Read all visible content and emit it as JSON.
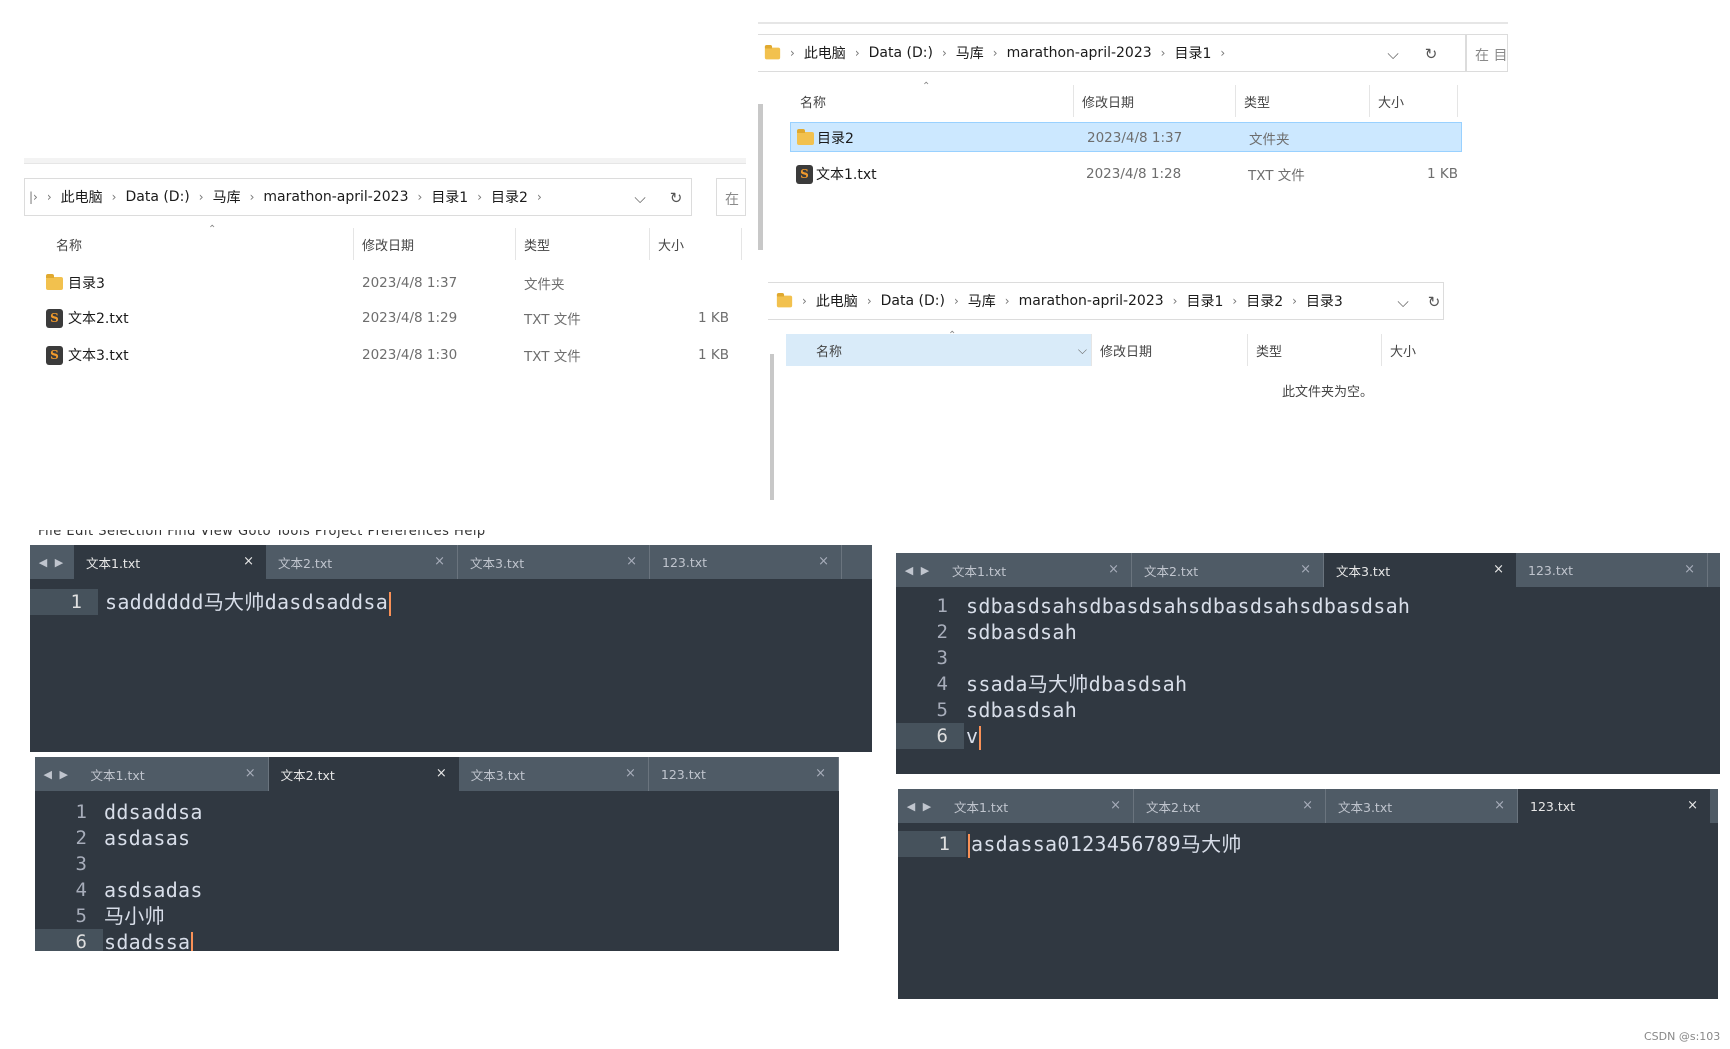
{
  "explorer1": {
    "crumbs": [
      "此电脑",
      "Data (D:)",
      "马库",
      "marathon-april-2023",
      "目录1",
      "目录2"
    ],
    "search_placeholder": "在 |",
    "columns": {
      "name": "名称",
      "modified": "修改日期",
      "type": "类型",
      "size": "大小"
    },
    "rows": [
      {
        "name": "目录3",
        "modified": "2023/4/8 1:37",
        "type": "文件夹",
        "size": "",
        "icon": "folder-icon"
      },
      {
        "name": "文本2.txt",
        "modified": "2023/4/8 1:29",
        "type": "TXT 文件",
        "size": "1 KB",
        "icon": "sublime-file-icon"
      },
      {
        "name": "文本3.txt",
        "modified": "2023/4/8 1:30",
        "type": "TXT 文件",
        "size": "1 KB",
        "icon": "sublime-file-icon"
      }
    ]
  },
  "explorer2": {
    "crumbs": [
      "此电脑",
      "Data (D:)",
      "马库",
      "marathon-april-2023",
      "目录1"
    ],
    "search_placeholder": "在 目",
    "columns": {
      "name": "名称",
      "modified": "修改日期",
      "type": "类型",
      "size": "大小"
    },
    "rows": [
      {
        "name": "目录2",
        "modified": "2023/4/8 1:37",
        "type": "文件夹",
        "size": "",
        "icon": "folder-icon"
      },
      {
        "name": "文本1.txt",
        "modified": "2023/4/8 1:28",
        "type": "TXT 文件",
        "size": "1 KB",
        "icon": "sublime-file-icon"
      }
    ]
  },
  "explorer3": {
    "crumbs": [
      "此电脑",
      "Data (D:)",
      "马库",
      "marathon-april-2023",
      "目录1",
      "目录2",
      "目录3"
    ],
    "columns": {
      "name": "名称",
      "modified": "修改日期",
      "type": "类型",
      "size": "大小"
    },
    "empty_text": "此文件夹为空。"
  },
  "menubar": "File   Edit   Selection   Find   View   Goto   Tools   Project   Preferences   Help",
  "tabs": [
    "文本1.txt",
    "文本2.txt",
    "文本3.txt",
    "123.txt"
  ],
  "editor1": {
    "active": 0,
    "lines": [
      "sadddddd马大帅dasdsaddsa"
    ]
  },
  "editor2": {
    "active": 1,
    "lines": [
      "ddsaddsa",
      "asdasas",
      "",
      "asdsadas",
      "马小帅",
      "sdadssa"
    ]
  },
  "editor3": {
    "active": 2,
    "lines": [
      "sdbasdsahsdbasdsahsdbasdsahsdbasdsah",
      "sdbasdsah",
      "",
      "ssada马大帅dbasdsah",
      "sdbasdsah",
      "v"
    ]
  },
  "editor4": {
    "active": 3,
    "lines": [
      "asdassa0123456789马大帅"
    ]
  },
  "line_numbers": [
    "1",
    "2",
    "3",
    "4",
    "5",
    "6"
  ],
  "tab_close": "×",
  "tab_arrows": "◀ ▶",
  "watermark": "CSDN @s:103",
  "colors": {
    "editor_bg": "#303841",
    "tabbar_bg": "#4f5b66",
    "caret": "#f99157",
    "selection": "#cce8ff"
  }
}
